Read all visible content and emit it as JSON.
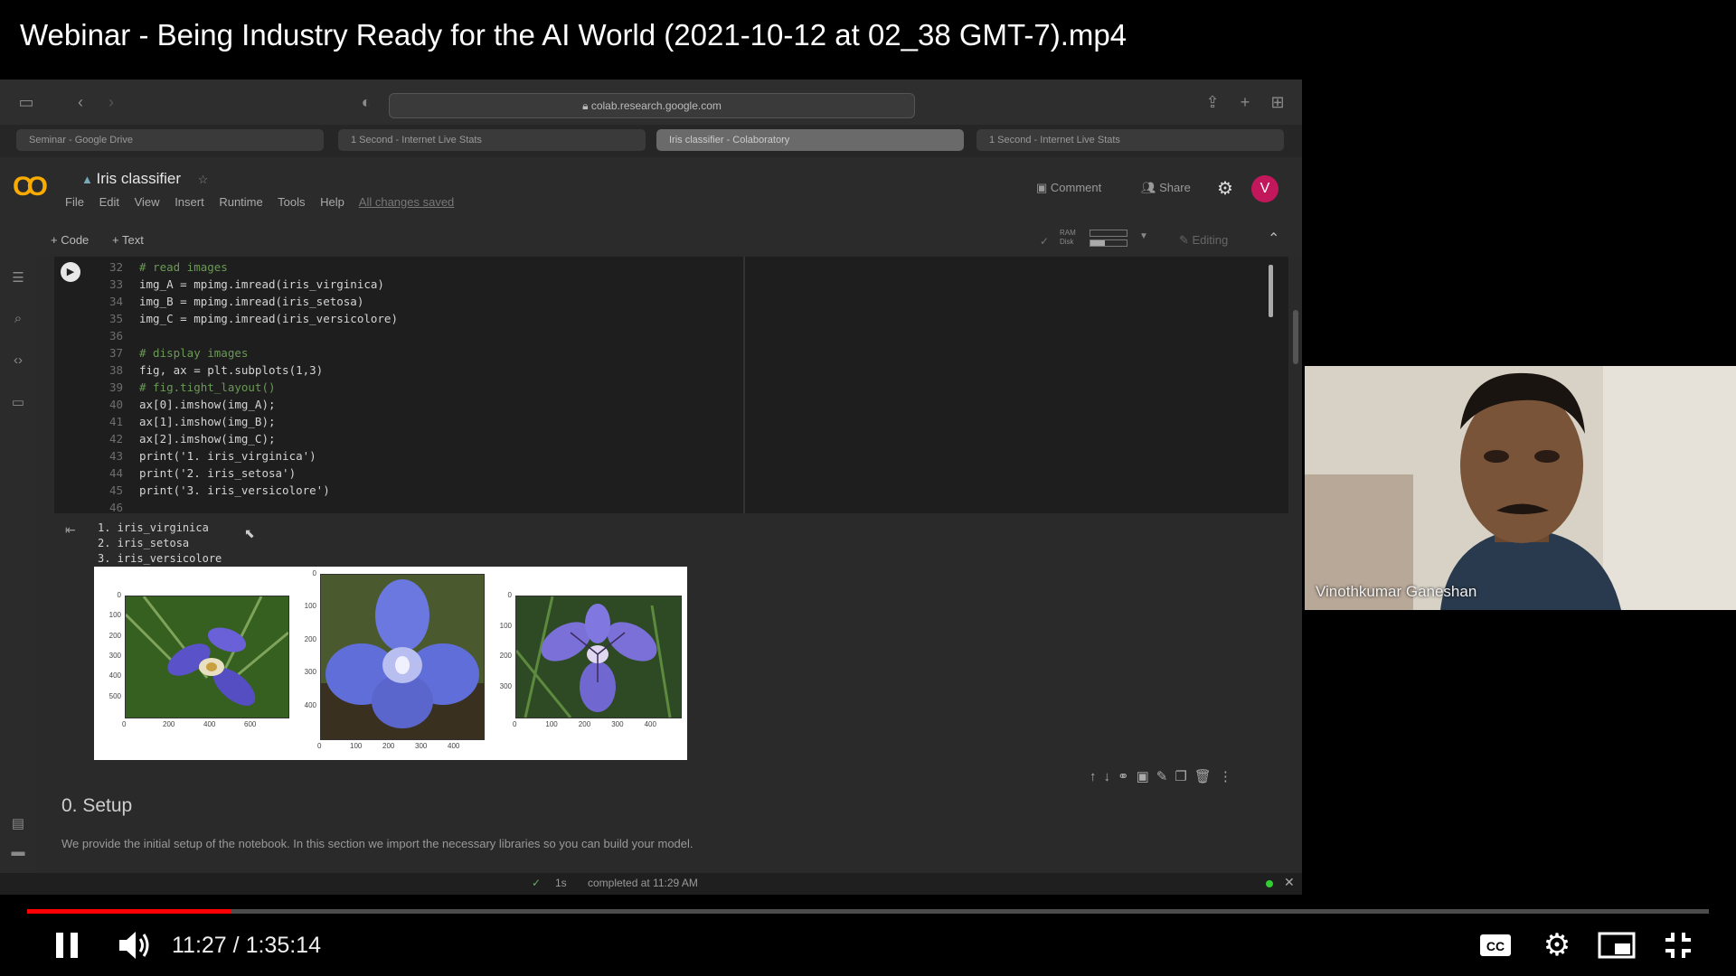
{
  "video": {
    "title": "Webinar - Being Industry Ready for the AI World (2021-10-12 at 02_38 GMT-7).mp4"
  },
  "browser": {
    "url": "colab.research.google.com",
    "tabs": [
      {
        "label": "Seminar - Google Drive",
        "active": false
      },
      {
        "label": "1 Second - Internet Live Stats",
        "active": false
      },
      {
        "label": "Iris classifier - Colaboratory",
        "active": true
      },
      {
        "label": "1 Second - Internet Live Stats",
        "active": false
      }
    ]
  },
  "colab": {
    "notebook_title": "Iris classifier",
    "menu": [
      "File",
      "Edit",
      "View",
      "Insert",
      "Runtime",
      "Tools",
      "Help"
    ],
    "saved_status": "All changes saved",
    "comment_label": "Comment",
    "share_label": "Share",
    "avatar_letter": "V",
    "add_code": "+ Code",
    "add_text": "+ Text",
    "ram_label": "RAM",
    "disk_label": "Disk",
    "editing_label": "Editing"
  },
  "code_cell": {
    "lines": [
      {
        "n": "32",
        "text": "# read images",
        "kind": "cm"
      },
      {
        "n": "33",
        "text": "img_A = mpimg.imread(iris_virginica)",
        "kind": "cd"
      },
      {
        "n": "34",
        "text": "img_B = mpimg.imread(iris_setosa)",
        "kind": "cd"
      },
      {
        "n": "35",
        "text": "img_C = mpimg.imread(iris_versicolore)",
        "kind": "cd"
      },
      {
        "n": "36",
        "text": "",
        "kind": "cd"
      },
      {
        "n": "37",
        "text": "# display images",
        "kind": "cm"
      },
      {
        "n": "38",
        "text": "fig, ax = plt.subplots(1,3)",
        "kind": "cd"
      },
      {
        "n": "39",
        "text": "# fig.tight_layout()",
        "kind": "cm"
      },
      {
        "n": "40",
        "text": "ax[0].imshow(img_A);",
        "kind": "cd"
      },
      {
        "n": "41",
        "text": "ax[1].imshow(img_B);",
        "kind": "cd"
      },
      {
        "n": "42",
        "text": "ax[2].imshow(img_C);",
        "kind": "cd"
      },
      {
        "n": "43",
        "text": "print('1. iris_virginica')",
        "kind": "cd"
      },
      {
        "n": "44",
        "text": "print('2. iris_setosa')",
        "kind": "cd"
      },
      {
        "n": "45",
        "text": "print('3. iris_versicolore')",
        "kind": "cd"
      },
      {
        "n": "46",
        "text": "",
        "kind": "cd"
      }
    ]
  },
  "output": {
    "lines": [
      "1. iris_virginica",
      "2. iris_setosa",
      "3. iris_versicolore"
    ],
    "axes": [
      {
        "yticks": [
          "0",
          "100",
          "200",
          "300",
          "400",
          "500"
        ],
        "xticks": [
          "0",
          "200",
          "400",
          "600"
        ]
      },
      {
        "yticks": [
          "0",
          "100",
          "200",
          "300",
          "400"
        ],
        "xticks": [
          "0",
          "100",
          "200",
          "300",
          "400"
        ]
      },
      {
        "yticks": [
          "0",
          "100",
          "200",
          "300"
        ],
        "xticks": [
          "0",
          "100",
          "200",
          "300",
          "400"
        ]
      }
    ]
  },
  "setup": {
    "title": "0. Setup",
    "description": "We provide the initial setup of the notebook. In this section we import the necessary libraries so you can build your model."
  },
  "status": {
    "check": "✓",
    "duration": "1s",
    "completed": "completed at 11:29 AM"
  },
  "participant": {
    "name": "Vinothkumar Ganeshan"
  },
  "player": {
    "current_time": "11:27",
    "separator": " / ",
    "total_time": "1:35:14",
    "progress_fraction": 0.1216,
    "accent": "#ff0000"
  }
}
